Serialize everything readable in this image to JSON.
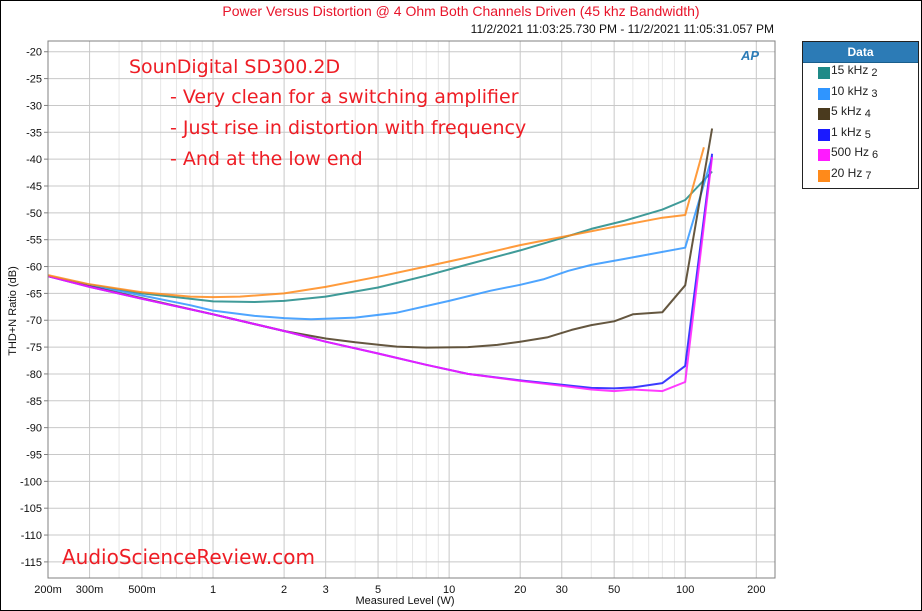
{
  "window": {
    "title": "Power Versus Distortion @ 4 Ohm Both Channels Driven (45 khz Bandwidth)",
    "subtitle": "11/2/2021 11:03:25.730 PM - 11/2/2021 11:05:31.057 PM",
    "logo": "AP"
  },
  "annotations": {
    "product": "SounDigital SD300.2D",
    "lines": [
      "- Very clean for a switching amplifier",
      "- Just rise in distortion with frequency",
      "- And at the low end"
    ],
    "watermark": "AudioScienceReview.com"
  },
  "legend": {
    "title": "Data",
    "items": [
      {
        "label": "15 kHz",
        "num": "2",
        "color": "#1f8a87"
      },
      {
        "label": "10 kHz",
        "num": "3",
        "color": "#2f95ff"
      },
      {
        "label": "5 kHz",
        "num": "4",
        "color": "#4a3a1e"
      },
      {
        "label": "1 kHz",
        "num": "5",
        "color": "#1a1aff"
      },
      {
        "label": "500 Hz",
        "num": "6",
        "color": "#ff1aff"
      },
      {
        "label": "20 Hz",
        "num": "7",
        "color": "#ff8a1a"
      }
    ]
  },
  "chart_data": {
    "type": "line",
    "title": "Power Versus Distortion @ 4 Ohm Both Channels Driven (45 khz Bandwidth)",
    "xlabel": "Measured Level (W)",
    "ylabel": "THD+N Ratio (dB)",
    "xscale": "log",
    "xlim": [
      0.2,
      240
    ],
    "ylim": [
      -118,
      -18
    ],
    "xticks": [
      0.2,
      0.3,
      0.5,
      1,
      2,
      3,
      5,
      10,
      20,
      30,
      50,
      100,
      200
    ],
    "xtick_labels": [
      "200m",
      "300m",
      "500m",
      "1",
      "2",
      "3",
      "5",
      "10",
      "20",
      "30",
      "50",
      "100",
      "200"
    ],
    "yticks": [
      -20,
      -25,
      -30,
      -35,
      -40,
      -45,
      -50,
      -55,
      -60,
      -65,
      -70,
      -75,
      -80,
      -85,
      -90,
      -95,
      -100,
      -105,
      -110,
      -115
    ],
    "ytick_labels": [
      "-20",
      "-25",
      "-30",
      "-35",
      "-40",
      "-45",
      "-50",
      "-55",
      "-60",
      "-65",
      "-70",
      "-75",
      "-80",
      "-85",
      "-90",
      "-95",
      "-100",
      "-105",
      "-110",
      "-115"
    ],
    "grid": true,
    "legend_position": "outside-right",
    "series": [
      {
        "name": "15 kHz 2",
        "color": "#1f8a87",
        "x": [
          0.2,
          0.3,
          0.5,
          0.8,
          1,
          1.5,
          2,
          3,
          5,
          8,
          12,
          20,
          28,
          40,
          55,
          80,
          100,
          130
        ],
        "y": [
          -61.8,
          -63.4,
          -65.0,
          -66.0,
          -66.5,
          -66.6,
          -66.4,
          -65.6,
          -63.9,
          -61.7,
          -59.6,
          -57.0,
          -55.1,
          -53.0,
          -51.5,
          -49.4,
          -47.6,
          -42.3
        ]
      },
      {
        "name": "10 kHz 3",
        "color": "#2f95ff",
        "x": [
          0.2,
          0.3,
          0.5,
          0.8,
          1,
          1.5,
          2,
          2.6,
          4,
          6,
          10,
          15,
          20,
          25,
          32,
          40,
          55,
          75,
          100,
          130
        ],
        "y": [
          -61.8,
          -63.5,
          -65.4,
          -67.2,
          -68.2,
          -69.2,
          -69.6,
          -69.8,
          -69.5,
          -68.6,
          -66.4,
          -64.5,
          -63.4,
          -62.4,
          -60.8,
          -59.7,
          -58.6,
          -57.5,
          -56.5,
          -39.5
        ]
      },
      {
        "name": "5 kHz 4",
        "color": "#4a3a1e",
        "x": [
          0.2,
          0.3,
          0.5,
          1,
          2,
          3,
          4,
          6,
          8,
          12,
          16,
          20,
          26,
          33,
          40,
          50,
          60,
          80,
          100,
          130
        ],
        "y": [
          -61.8,
          -63.7,
          -65.9,
          -68.9,
          -72.0,
          -73.4,
          -74.1,
          -74.9,
          -75.1,
          -75.0,
          -74.6,
          -74.0,
          -73.2,
          -71.8,
          -70.9,
          -70.2,
          -68.9,
          -68.5,
          -63.5,
          -34.3
        ]
      },
      {
        "name": "1 kHz 5",
        "color": "#1a1aff",
        "x": [
          0.2,
          0.3,
          0.5,
          1,
          2,
          3,
          5,
          8,
          12,
          20,
          30,
          40,
          50,
          60,
          80,
          100,
          130
        ],
        "y": [
          -61.8,
          -63.8,
          -66.0,
          -68.9,
          -72.0,
          -74.0,
          -76.2,
          -78.3,
          -80.0,
          -81.2,
          -82.0,
          -82.6,
          -82.7,
          -82.5,
          -81.7,
          -78.5,
          -39.0
        ]
      },
      {
        "name": "500 Hz 6",
        "color": "#ff1aff",
        "x": [
          0.2,
          0.3,
          0.5,
          1,
          2,
          3,
          5,
          8,
          12,
          20,
          30,
          40,
          50,
          60,
          80,
          100,
          130
        ],
        "y": [
          -61.8,
          -63.8,
          -66.0,
          -68.9,
          -72.0,
          -74.0,
          -76.2,
          -78.3,
          -80.0,
          -81.3,
          -82.2,
          -82.9,
          -83.2,
          -82.9,
          -83.2,
          -81.5,
          -39.6
        ]
      },
      {
        "name": "20 Hz 7",
        "color": "#ff8a1a",
        "x": [
          0.2,
          0.3,
          0.5,
          0.8,
          1,
          1.3,
          2,
          3,
          5,
          8,
          12,
          20,
          30,
          50,
          80,
          100,
          120
        ],
        "y": [
          -61.6,
          -63.3,
          -64.8,
          -65.6,
          -65.7,
          -65.6,
          -65.0,
          -63.8,
          -61.9,
          -60.0,
          -58.3,
          -56.0,
          -54.5,
          -52.6,
          -50.9,
          -50.4,
          -37.8
        ]
      }
    ]
  }
}
